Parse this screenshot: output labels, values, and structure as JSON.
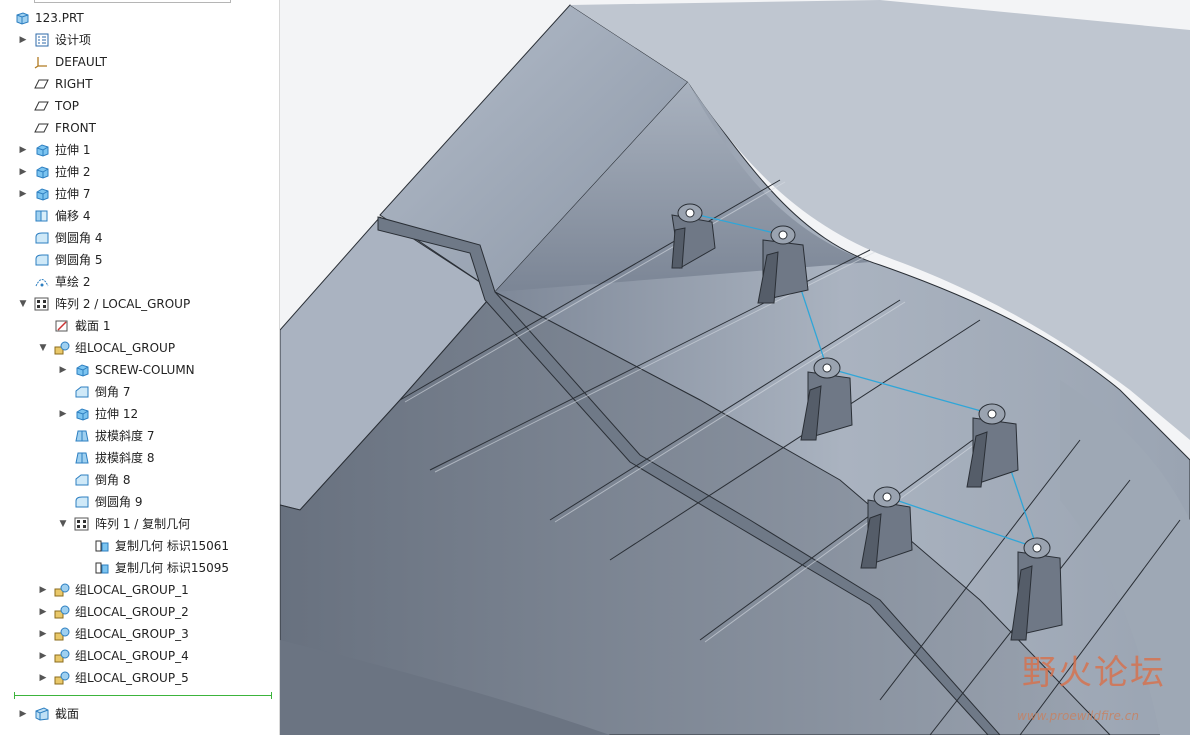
{
  "model_tree": {
    "items": [
      {
        "label": "123.PRT",
        "icon": "part-icon",
        "level": 0,
        "caret": ""
      },
      {
        "label": "设计项",
        "icon": "design-items-icon",
        "level": 1,
        "caret": "collapsed"
      },
      {
        "label": "DEFAULT",
        "icon": "coordinate-system-icon",
        "level": 1,
        "caret": ""
      },
      {
        "label": "RIGHT",
        "icon": "datum-plane-icon",
        "level": 1,
        "caret": ""
      },
      {
        "label": "TOP",
        "icon": "datum-plane-icon",
        "level": 1,
        "caret": ""
      },
      {
        "label": "FRONT",
        "icon": "datum-plane-icon",
        "level": 1,
        "caret": ""
      },
      {
        "label": "拉伸 1",
        "icon": "extrude-icon",
        "level": 1,
        "caret": "collapsed"
      },
      {
        "label": "拉伸 2",
        "icon": "extrude-icon",
        "level": 1,
        "caret": "collapsed"
      },
      {
        "label": "拉伸 7",
        "icon": "extrude-icon",
        "level": 1,
        "caret": "collapsed"
      },
      {
        "label": "偏移 4",
        "icon": "offset-icon",
        "level": 1,
        "caret": ""
      },
      {
        "label": "倒圆角 4",
        "icon": "round-icon",
        "level": 1,
        "caret": ""
      },
      {
        "label": "倒圆角 5",
        "icon": "round-icon",
        "level": 1,
        "caret": ""
      },
      {
        "label": "草绘 2",
        "icon": "sketch-icon",
        "level": 1,
        "caret": ""
      },
      {
        "label": "阵列 2 / LOCAL_GROUP",
        "icon": "pattern-icon",
        "level": 1,
        "caret": "expanded"
      },
      {
        "label": "截面 1",
        "icon": "section-sketch-icon",
        "level": 2,
        "caret": ""
      },
      {
        "label": "组LOCAL_GROUP",
        "icon": "group-icon",
        "level": 2,
        "caret": "expanded"
      },
      {
        "label": "SCREW-COLUMN",
        "icon": "extrude-icon",
        "level": 3,
        "caret": "collapsed"
      },
      {
        "label": "倒角 7",
        "icon": "chamfer-icon",
        "level": 3,
        "caret": ""
      },
      {
        "label": "拉伸 12",
        "icon": "extrude-icon",
        "level": 3,
        "caret": "collapsed"
      },
      {
        "label": "拔模斜度 7",
        "icon": "draft-icon",
        "level": 3,
        "caret": ""
      },
      {
        "label": "拔模斜度 8",
        "icon": "draft-icon",
        "level": 3,
        "caret": ""
      },
      {
        "label": "倒角 8",
        "icon": "chamfer-icon",
        "level": 3,
        "caret": ""
      },
      {
        "label": "倒圆角 9",
        "icon": "round-icon",
        "level": 3,
        "caret": ""
      },
      {
        "label": "阵列 1 / 复制几何",
        "icon": "pattern-icon",
        "level": 3,
        "caret": "expanded"
      },
      {
        "label": "复制几何 标识15061",
        "icon": "copy-geometry-icon",
        "level": 4,
        "caret": ""
      },
      {
        "label": "复制几何 标识15095",
        "icon": "copy-geometry-icon",
        "level": 4,
        "caret": ""
      },
      {
        "label": "组LOCAL_GROUP_1",
        "icon": "group-icon",
        "level": 2,
        "caret": "collapsed"
      },
      {
        "label": "组LOCAL_GROUP_2",
        "icon": "group-icon",
        "level": 2,
        "caret": "collapsed"
      },
      {
        "label": "组LOCAL_GROUP_3",
        "icon": "group-icon",
        "level": 2,
        "caret": "collapsed"
      },
      {
        "label": "组LOCAL_GROUP_4",
        "icon": "group-icon",
        "level": 2,
        "caret": "collapsed"
      },
      {
        "label": "组LOCAL_GROUP_5",
        "icon": "group-icon",
        "level": 2,
        "caret": "collapsed"
      }
    ],
    "footer_item": {
      "label": "截面",
      "icon": "section-icon",
      "caret": "collapsed"
    }
  },
  "viewport": {
    "model_colors": {
      "top": "#a7b1bf",
      "side": "#8a95a4",
      "dark": "#5d6674",
      "edge": "#2a2f36",
      "link": "#2fa6d8"
    }
  },
  "watermark": {
    "title": "野火论坛",
    "url": "www.proewildfire.cn"
  }
}
